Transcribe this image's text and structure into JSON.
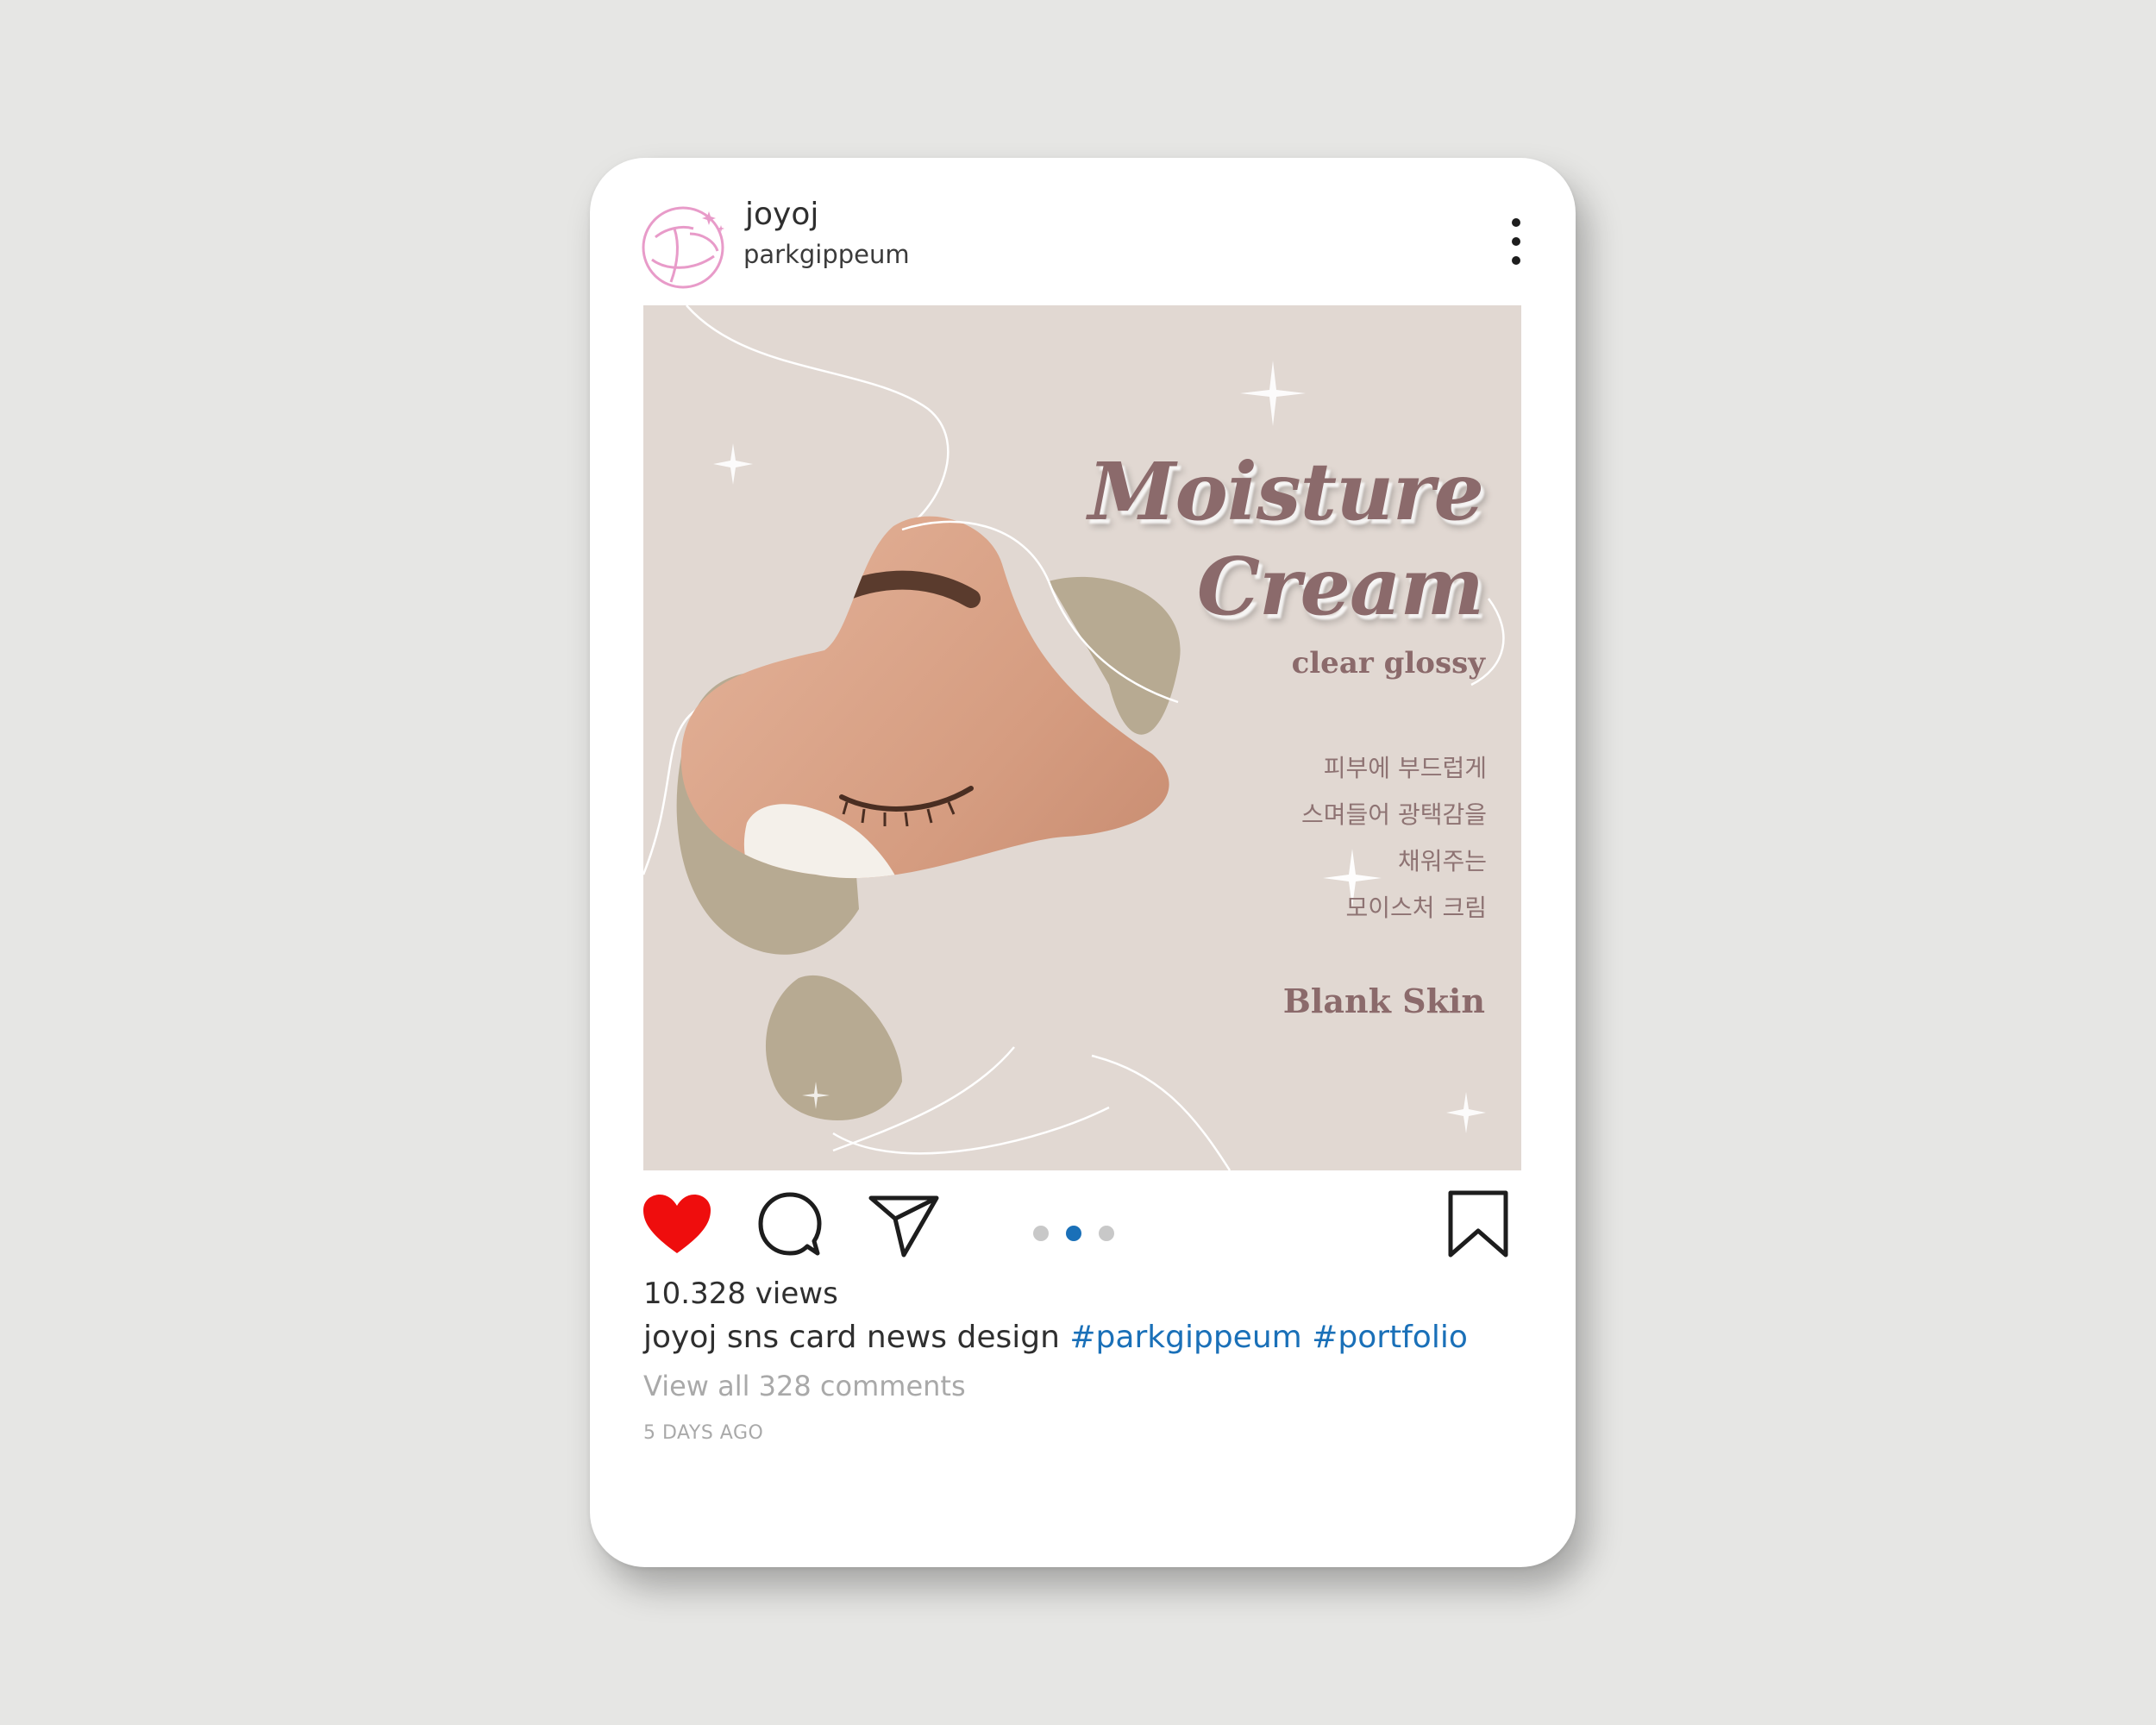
{
  "post": {
    "username": "joyoj",
    "handle": "parkgippeum",
    "image": {
      "title_line1": "Moisture",
      "title_line2": "Cream",
      "subtitle": "clear glossy",
      "korean_copy": "피부에 부드럽게\n스며들어 광택감을\n채워주는\n모이스처 크림",
      "brand": "Blank Skin"
    },
    "carousel": {
      "count": 3,
      "active_index": 1
    },
    "views": "10.328 views",
    "caption": {
      "username": "joyoj",
      "text": "sns card news design",
      "tags": [
        "#parkgippeum",
        "#portfolio"
      ]
    },
    "comments_link": "View all 328 comments",
    "timestamp": "5 DAYS AGO"
  },
  "icons": {
    "avatar": "joyoj-logo-icon",
    "more": "more-vertical-icon",
    "like": "heart-icon",
    "comment": "comment-icon",
    "share": "send-icon",
    "save": "bookmark-icon"
  },
  "colors": {
    "background": "#e6e6e4",
    "card": "#ffffff",
    "heart": "#ef0d0d",
    "hashtag": "#1a70b8",
    "carousel_active": "#1a70b8",
    "image_bg": "#e1d8d2",
    "title_text": "#8b6a6b",
    "accent_pink": "#e89bc9"
  }
}
